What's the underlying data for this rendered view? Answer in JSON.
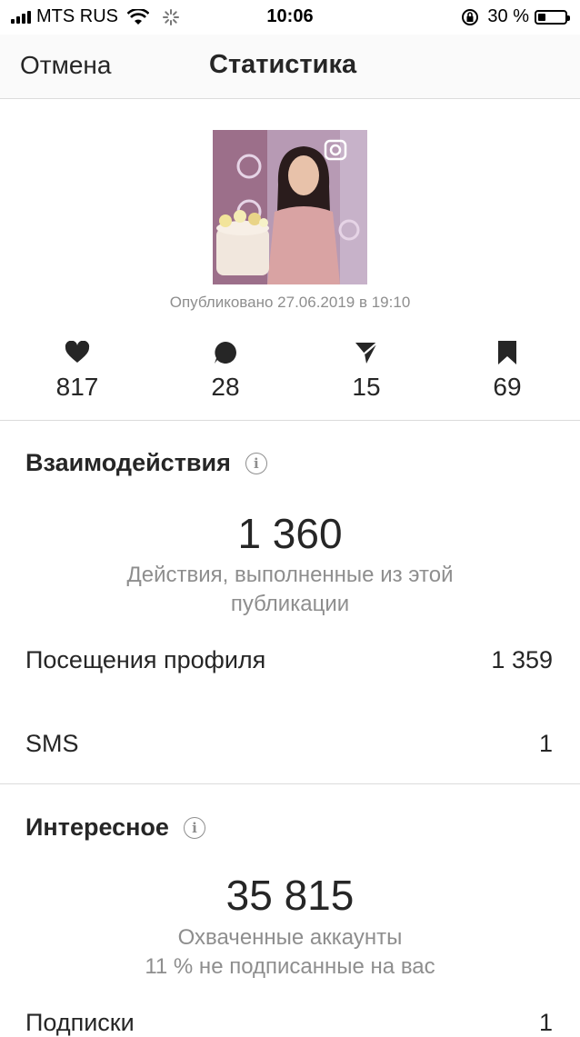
{
  "status_bar": {
    "carrier": "MTS RUS",
    "time": "10:06",
    "battery_percent": "30 %",
    "battery_level": 0.3
  },
  "nav": {
    "cancel": "Отмена",
    "title": "Статистика"
  },
  "post": {
    "published": "Опубликовано 27.06.2019 в 19:10"
  },
  "metrics": [
    {
      "icon": "heart-icon",
      "value": "817"
    },
    {
      "icon": "comment-icon",
      "value": "28"
    },
    {
      "icon": "send-icon",
      "value": "15"
    },
    {
      "icon": "bookmark-icon",
      "value": "69"
    }
  ],
  "interactions": {
    "title": "Взаимодействия",
    "total": "1 360",
    "caption_line1": "Действия, выполненные из этой",
    "caption_line2": "публикации",
    "rows": [
      {
        "label": "Посещения профиля",
        "value": "1 359"
      },
      {
        "label": "SMS",
        "value": "1"
      }
    ]
  },
  "discovery": {
    "title": "Интересное",
    "total": "35 815",
    "caption_line1": "Охваченные аккаунты",
    "caption_line2": "11 % не подписанные на вас",
    "rows": [
      {
        "label": "Подписки",
        "value": "1"
      }
    ]
  },
  "colors": {
    "text": "#262626",
    "secondary": "#8e8e8e",
    "divider": "#dbdbdb"
  }
}
